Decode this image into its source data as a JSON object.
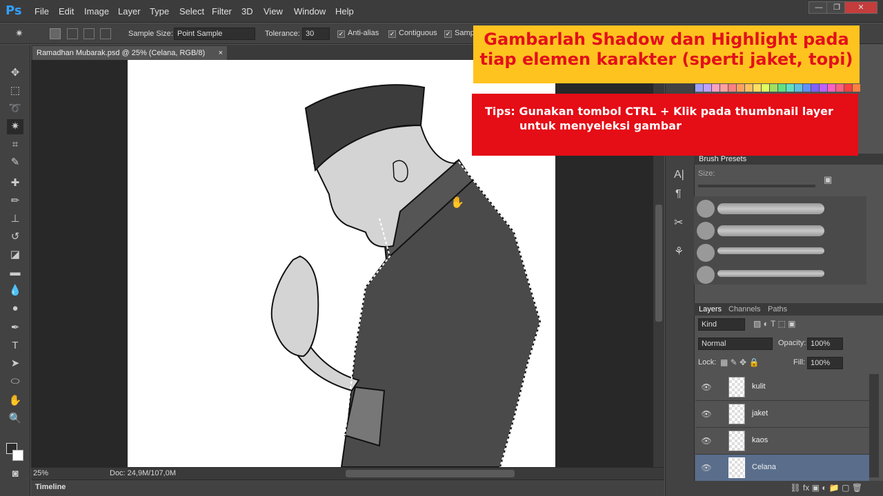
{
  "app": {
    "logo": "Ps"
  },
  "menu": [
    "File",
    "Edit",
    "Image",
    "Layer",
    "Type",
    "Select",
    "Filter",
    "3D",
    "View",
    "Window",
    "Help"
  ],
  "window_controls": {
    "minimize": "—",
    "restore": "❐",
    "close": "✕"
  },
  "options_bar": {
    "sample_size_label": "Sample Size:",
    "sample_size_value": "Point Sample",
    "tolerance_label": "Tolerance:",
    "tolerance_value": "30",
    "anti_alias_label": "Anti-alias",
    "contiguous_label": "Contiguous",
    "sample_all_label": "Samp"
  },
  "document": {
    "tab_title": "Ramadhan Mubarak.psd @ 25% (Celana, RGB/8)",
    "close": "×"
  },
  "status": {
    "zoom": "25%",
    "doc": "Doc: 24,9M/107,0M"
  },
  "timeline_label": "Timeline",
  "overlay": {
    "title": "Gambarlah Shadow dan Highlight pada tiap elemen karakter (sperti jaket, topi)",
    "tips_line1": "Tips: Gunakan tombol CTRL + Klik pada thumbnail layer",
    "tips_line2": "untuk menyeleksi  gambar"
  },
  "brush_presets": {
    "tab": "Brush Presets",
    "size_label": "Size:"
  },
  "layers_panel": {
    "tabs": [
      "Layers",
      "Channels",
      "Paths"
    ],
    "kind_label": "Kind",
    "blend_mode": "Normal",
    "opacity_label": "Opacity:",
    "opacity_value": "100%",
    "lock_label": "Lock:",
    "fill_label": "Fill:",
    "fill_value": "100%",
    "layers": [
      {
        "name": "kulit",
        "selected": false
      },
      {
        "name": "jaket",
        "selected": false
      },
      {
        "name": "kaos",
        "selected": false
      },
      {
        "name": "Celana",
        "selected": true
      }
    ]
  },
  "colors": {
    "accent_selected": "#5a6e8c",
    "banner_yellow": "#ffc31f",
    "banner_red": "#e50d16"
  }
}
